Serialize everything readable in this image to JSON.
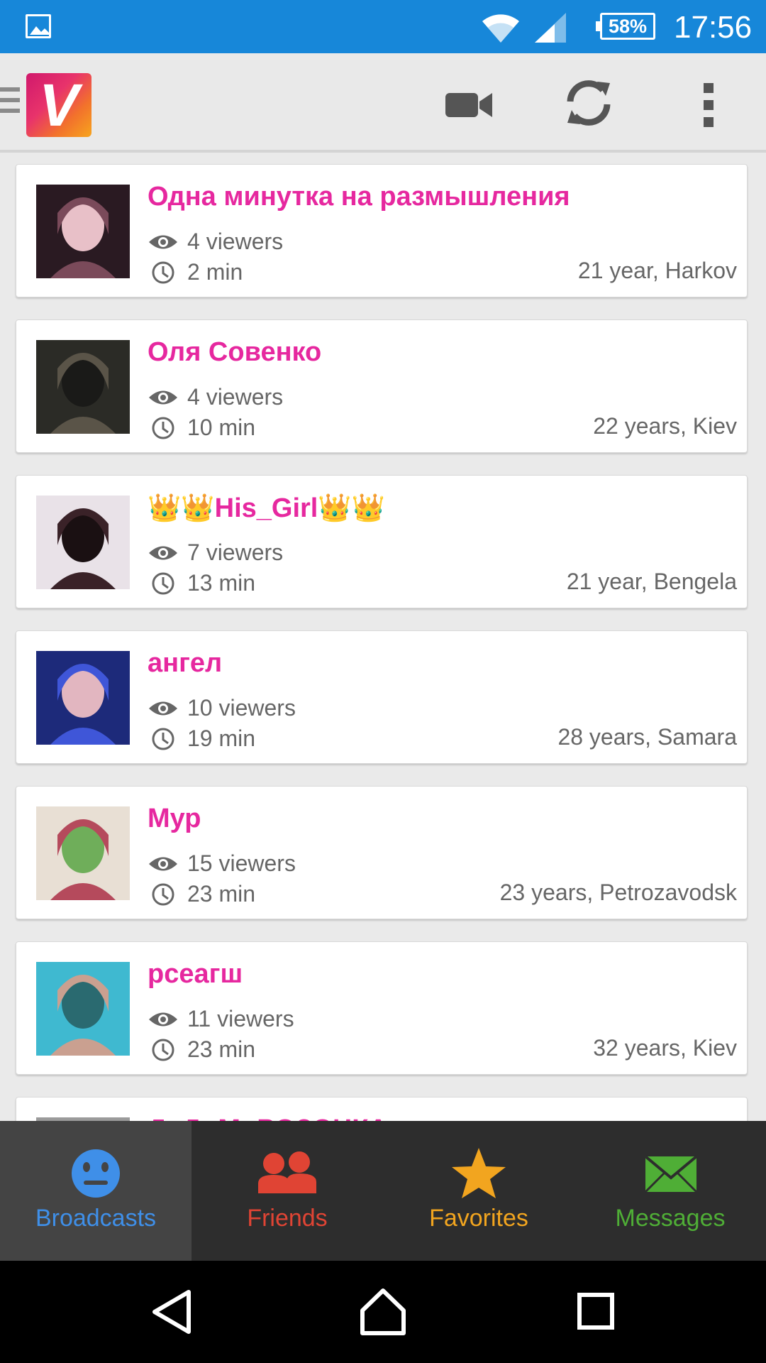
{
  "status_bar": {
    "battery": "58%",
    "time": "17:56"
  },
  "app_bar": {
    "logo_letter": "V"
  },
  "broadcasts": [
    {
      "name": "Одна минутка на размышления",
      "viewers": "4 viewers",
      "duration": "2 min",
      "info": "21 year, Harkov",
      "thumb_colors": [
        "#2a1a22",
        "#7a4a5a",
        "#e8c0c8"
      ]
    },
    {
      "name": "Оля Совенко",
      "viewers": "4 viewers",
      "duration": "10 min",
      "info": "22 years, Kiev",
      "thumb_colors": [
        "#2b2b26",
        "#5a5448",
        "#1a1a18"
      ]
    },
    {
      "name": "👑👑His_Girl👑👑",
      "viewers": "7 viewers",
      "duration": "13 min",
      "info": "21 year, Bengela",
      "thumb_colors": [
        "#e9e2e8",
        "#3a2228",
        "#1a1012"
      ]
    },
    {
      "name": "ангел",
      "viewers": "10 viewers",
      "duration": "19 min",
      "info": "28 years, Samara",
      "thumb_colors": [
        "#1d2a7a",
        "#3f56d8",
        "#e2b6c0"
      ]
    },
    {
      "name": "Мур",
      "viewers": "15 viewers",
      "duration": "23 min",
      "info": "23 years, Petrozavodsk",
      "thumb_colors": [
        "#e8dfd4",
        "#b54a5c",
        "#6fae5a"
      ]
    },
    {
      "name": "рсеагш",
      "viewers": "11 viewers",
      "duration": "23 min",
      "info": "32 years, Kiev",
      "thumb_colors": [
        "#3fb9d0",
        "#caa090",
        "#2a6a70"
      ]
    },
    {
      "name": "ДеДоМоРОЗОЧКА",
      "viewers": "",
      "duration": "",
      "info": "",
      "thumb_colors": [
        "#9a9a9a",
        "#bbbbbb",
        "#777777"
      ]
    }
  ],
  "bottom_nav": {
    "items": [
      {
        "label": "Broadcasts",
        "color": "#3f8fe8"
      },
      {
        "label": "Friends",
        "color": "#e04434"
      },
      {
        "label": "Favorites",
        "color": "#f2a51f"
      },
      {
        "label": "Messages",
        "color": "#4fae36"
      }
    ]
  }
}
